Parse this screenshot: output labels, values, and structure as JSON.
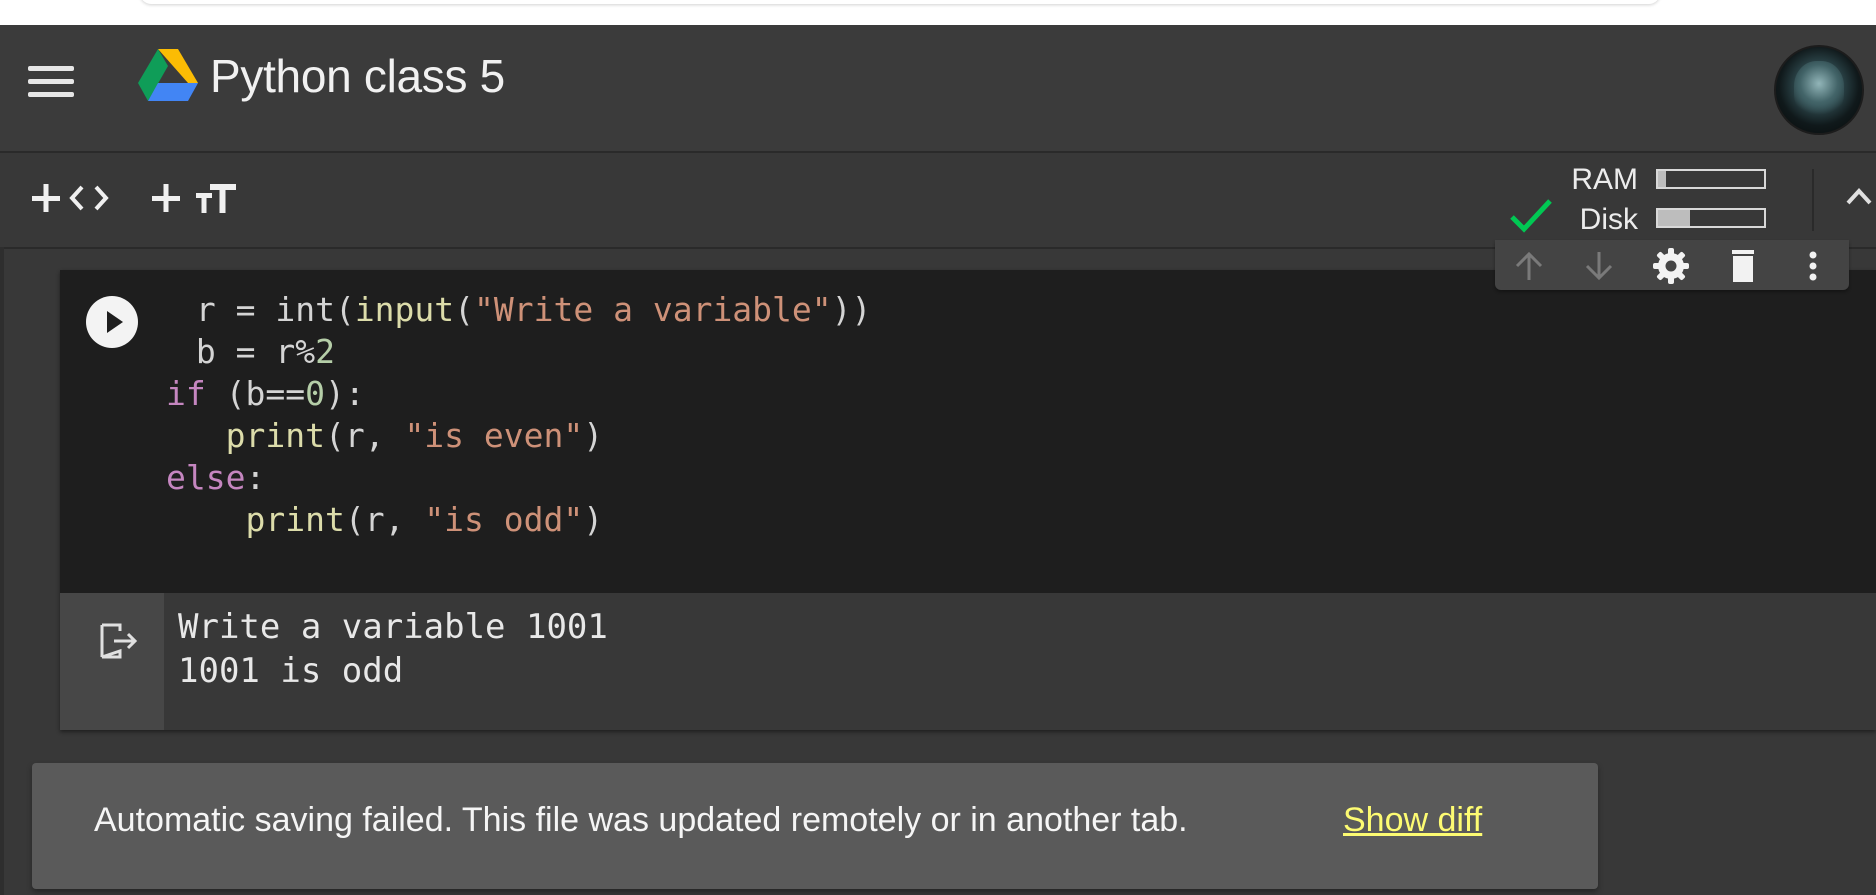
{
  "header": {
    "title": "Python class 5"
  },
  "toolbar": {
    "add_code_icon": "plus-code-icon",
    "add_text_icon": "plus-text-icon",
    "ram_label": "RAM",
    "disk_label": "Disk",
    "ram_usage": 0.08,
    "disk_usage": 0.3
  },
  "cell": {
    "code_lines": [
      " r = int(input(\"Write a variable\"))",
      " b = r%2",
      "if (b==0):",
      "   print(r, \"is even\")",
      "else:",
      "    print(r, \"is odd\")"
    ],
    "output_lines": [
      "Write a variable 1001",
      "1001 is odd"
    ]
  },
  "snackbar": {
    "message": "Automatic saving failed. This file was updated remotely or in another tab.",
    "action": "Show diff"
  },
  "colors": {
    "accent_check": "#00c853",
    "link": "#fdfb72",
    "keyword": "#c586c0",
    "function": "#dcdcaa",
    "string": "#ce9178",
    "number": "#b5cea8"
  }
}
